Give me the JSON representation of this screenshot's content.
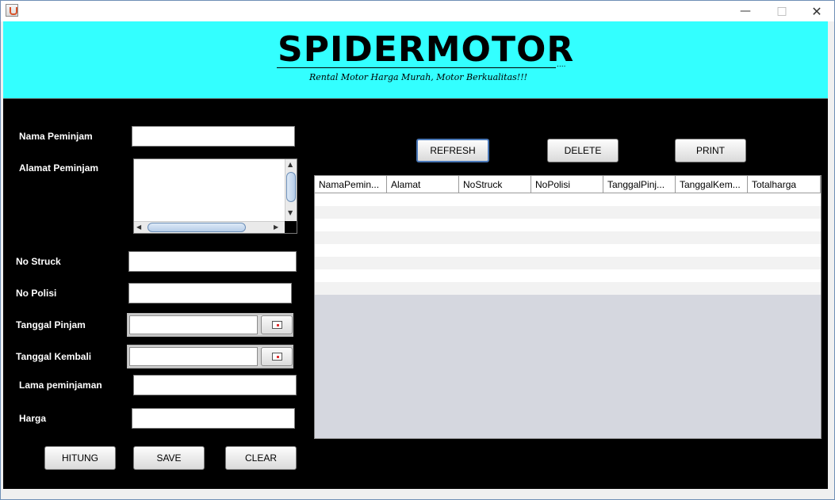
{
  "window": {
    "minimize": "—",
    "maximize": "□",
    "close": "✕"
  },
  "header": {
    "title": "SPIDERMOTOR",
    "dots": "....",
    "tagline": "Rental Motor Harga Murah, Motor Berkualitas!!!",
    "bg_color": "#33ffff"
  },
  "form": {
    "nama_label": "Nama Peminjam",
    "alamat_label": "Alamat Peminjam",
    "struck_label": "No Struck",
    "polisi_label": "No Polisi",
    "tgl_pinjam_label": "Tanggal Pinjam",
    "tgl_kembali_label": "Tanggal Kembali",
    "lama_label": "Lama peminjaman",
    "harga_label": "Harga"
  },
  "buttons": {
    "hitung": "HITUNG",
    "save": "SAVE",
    "clear": "CLEAR",
    "refresh": "REFRESH",
    "delete": "DELETE",
    "print": "PRINT"
  },
  "table": {
    "columns": [
      "NamaPemin...",
      "Alamat",
      "NoStruck",
      "NoPolisi",
      "TanggalPinj...",
      "TanggalKem...",
      "Totalharga"
    ],
    "empty_rows": 8
  },
  "icons": {
    "app": "java-app-icon",
    "calendar": "calendar-icon"
  }
}
